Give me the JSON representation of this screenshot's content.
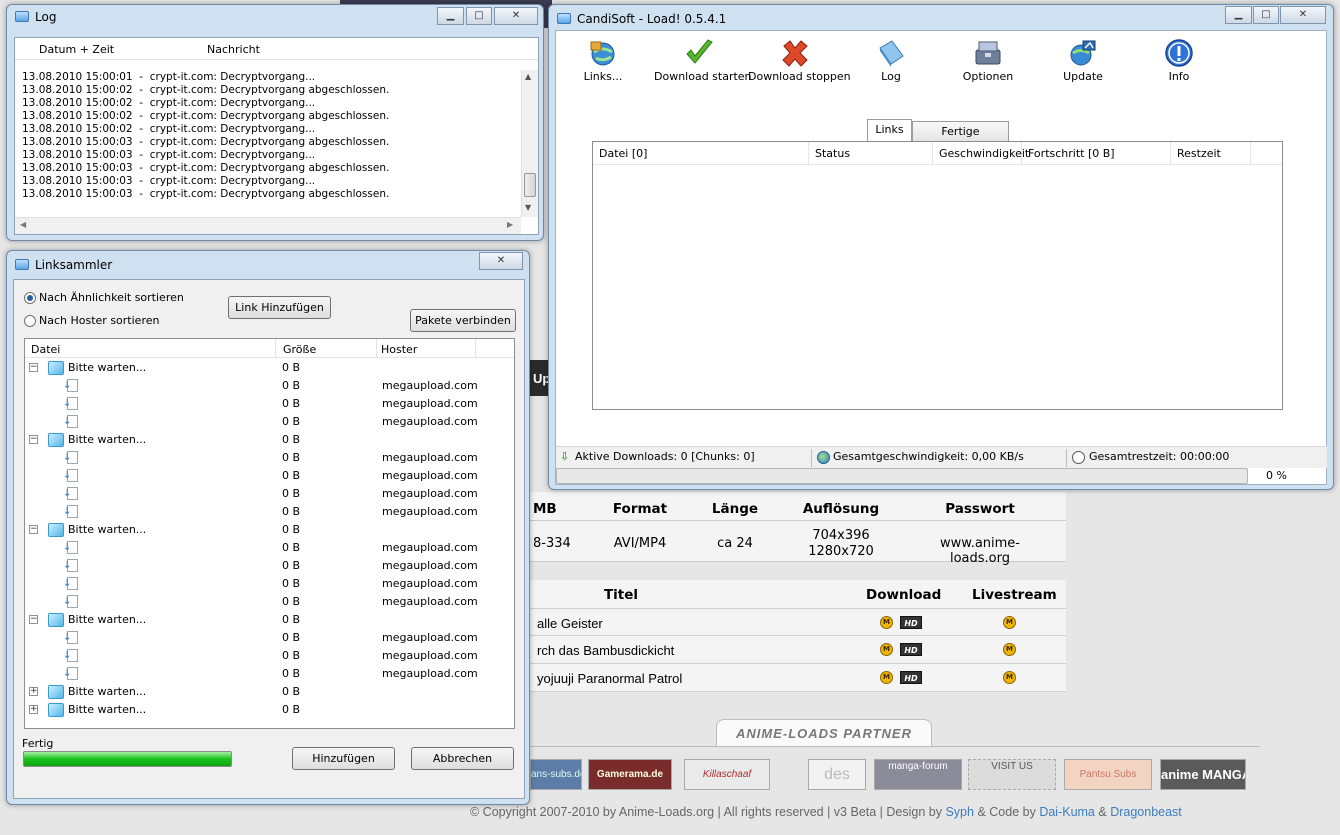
{
  "background": {
    "table1": {
      "headers": [
        "MB",
        "Format",
        "Länge",
        "Auflösung",
        "Passwort"
      ],
      "row": {
        "mb": "8-334",
        "format": "AVI/MP4",
        "laenge": "ca 24",
        "aufloesung_1": "704x396",
        "aufloesung_2": "1280x720",
        "passwort": "www.anime-loads.org"
      }
    },
    "table2": {
      "headers": [
        "Titel",
        "Download",
        "Livestream"
      ],
      "rows": [
        {
          "title": "alle Geister"
        },
        {
          "title": "rch das Bambusdickicht"
        },
        {
          "title": "yojuuji Paranormal Patrol"
        }
      ],
      "hd_label": "HD",
      "m_label": "M"
    },
    "up_fragment": "Up",
    "partner_title": "ANIME-LOADS PARTNER",
    "banners": [
      "ans-subs.de",
      "Gamerama.de",
      "Killaschaaf",
      "des",
      "manga-forum",
      "VISIT US",
      "Pantsu Subs",
      "anime MANGA"
    ],
    "footer": {
      "text1": "© Copyright 2007-2010 by Anime-Loads.org | All rights reserved | v3 Beta | Design by",
      "link1": "Syph",
      "text2": "& Code by",
      "link2": "Dai-Kuma",
      "text3": "&",
      "link3": "Dragonbeast"
    }
  },
  "log_window": {
    "title": "Log",
    "columns": [
      "Datum + Zeit",
      "Nachricht"
    ],
    "lines": [
      "13.08.2010 15:00:01  -  crypt-it.com: Decryptvorgang...",
      "13.08.2010 15:00:02  -  crypt-it.com: Decryptvorgang abgeschlossen.",
      "13.08.2010 15:00:02  -  crypt-it.com: Decryptvorgang...",
      "13.08.2010 15:00:02  -  crypt-it.com: Decryptvorgang abgeschlossen.",
      "13.08.2010 15:00:02  -  crypt-it.com: Decryptvorgang...",
      "13.08.2010 15:00:03  -  crypt-it.com: Decryptvorgang abgeschlossen.",
      "13.08.2010 15:00:03  -  crypt-it.com: Decryptvorgang...",
      "13.08.2010 15:00:03  -  crypt-it.com: Decryptvorgang abgeschlossen.",
      "13.08.2010 15:00:03  -  crypt-it.com: Decryptvorgang...",
      "13.08.2010 15:00:03  -  crypt-it.com: Decryptvorgang abgeschlossen."
    ]
  },
  "linksammler": {
    "title": "Linksammler",
    "sort_similarity": "Nach Ähnlichkeit sortieren",
    "sort_hoster": "Nach Hoster sortieren",
    "link_add_button": "Link Hinzufügen",
    "merge_packages_button": "Pakete verbinden",
    "columns": [
      "Datei",
      "Größe",
      "Hoster"
    ],
    "rows": [
      {
        "type": "package",
        "expanded": true,
        "name": "Bitte warten...",
        "size": "0 B",
        "hoster": ""
      },
      {
        "type": "file",
        "name": "",
        "size": "0 B",
        "hoster": "megaupload.com"
      },
      {
        "type": "file",
        "name": "",
        "size": "0 B",
        "hoster": "megaupload.com"
      },
      {
        "type": "file",
        "name": "",
        "size": "0 B",
        "hoster": "megaupload.com"
      },
      {
        "type": "package",
        "expanded": true,
        "name": "Bitte warten...",
        "size": "0 B",
        "hoster": ""
      },
      {
        "type": "file",
        "name": "",
        "size": "0 B",
        "hoster": "megaupload.com"
      },
      {
        "type": "file",
        "name": "",
        "size": "0 B",
        "hoster": "megaupload.com"
      },
      {
        "type": "file",
        "name": "",
        "size": "0 B",
        "hoster": "megaupload.com"
      },
      {
        "type": "file",
        "name": "",
        "size": "0 B",
        "hoster": "megaupload.com"
      },
      {
        "type": "package",
        "expanded": true,
        "name": "Bitte warten...",
        "size": "0 B",
        "hoster": ""
      },
      {
        "type": "file",
        "name": "",
        "size": "0 B",
        "hoster": "megaupload.com"
      },
      {
        "type": "file",
        "name": "",
        "size": "0 B",
        "hoster": "megaupload.com"
      },
      {
        "type": "file",
        "name": "",
        "size": "0 B",
        "hoster": "megaupload.com"
      },
      {
        "type": "file",
        "name": "",
        "size": "0 B",
        "hoster": "megaupload.com"
      },
      {
        "type": "package",
        "expanded": true,
        "name": "Bitte warten...",
        "size": "0 B",
        "hoster": ""
      },
      {
        "type": "file",
        "name": "",
        "size": "0 B",
        "hoster": "megaupload.com"
      },
      {
        "type": "file",
        "name": "",
        "size": "0 B",
        "hoster": "megaupload.com"
      },
      {
        "type": "file",
        "name": "",
        "size": "0 B",
        "hoster": "megaupload.com"
      },
      {
        "type": "package",
        "expanded": false,
        "name": "Bitte warten...",
        "size": "0 B",
        "hoster": ""
      },
      {
        "type": "package",
        "expanded": false,
        "name": "Bitte warten...",
        "size": "0 B",
        "hoster": ""
      }
    ],
    "status_label": "Fertig",
    "progress": 1.0,
    "add_button": "Hinzufügen",
    "cancel_button": "Abbrechen"
  },
  "candisoft": {
    "title": "CandiSoft - Load! 0.5.4.1",
    "toolbar": [
      {
        "label": "Links...",
        "icon": "globe-links-icon"
      },
      {
        "label": "Download starten",
        "icon": "checkmark-icon"
      },
      {
        "label": "Download stoppen",
        "icon": "red-x-icon"
      },
      {
        "label": "Log",
        "icon": "log-book-icon"
      },
      {
        "label": "Optionen",
        "icon": "toolbox-icon"
      },
      {
        "label": "Update",
        "icon": "globe-update-icon"
      },
      {
        "label": "Info",
        "icon": "info-icon"
      }
    ],
    "tabs": [
      "Links",
      "Fertige Downloads"
    ],
    "grid_columns": [
      "Datei [0]",
      "Status",
      "Geschwindigkeit",
      "Fortschritt [0 B]",
      "Restzeit"
    ],
    "status": {
      "active": "Aktive Downloads: 0 [Chunks: 0]",
      "speed": "Gesamtgeschwindigkeit: 0,00 KB/s",
      "remaining": "Gesamtrestzeit: 00:00:00"
    },
    "progress_text": "0 %",
    "progress": 0
  }
}
